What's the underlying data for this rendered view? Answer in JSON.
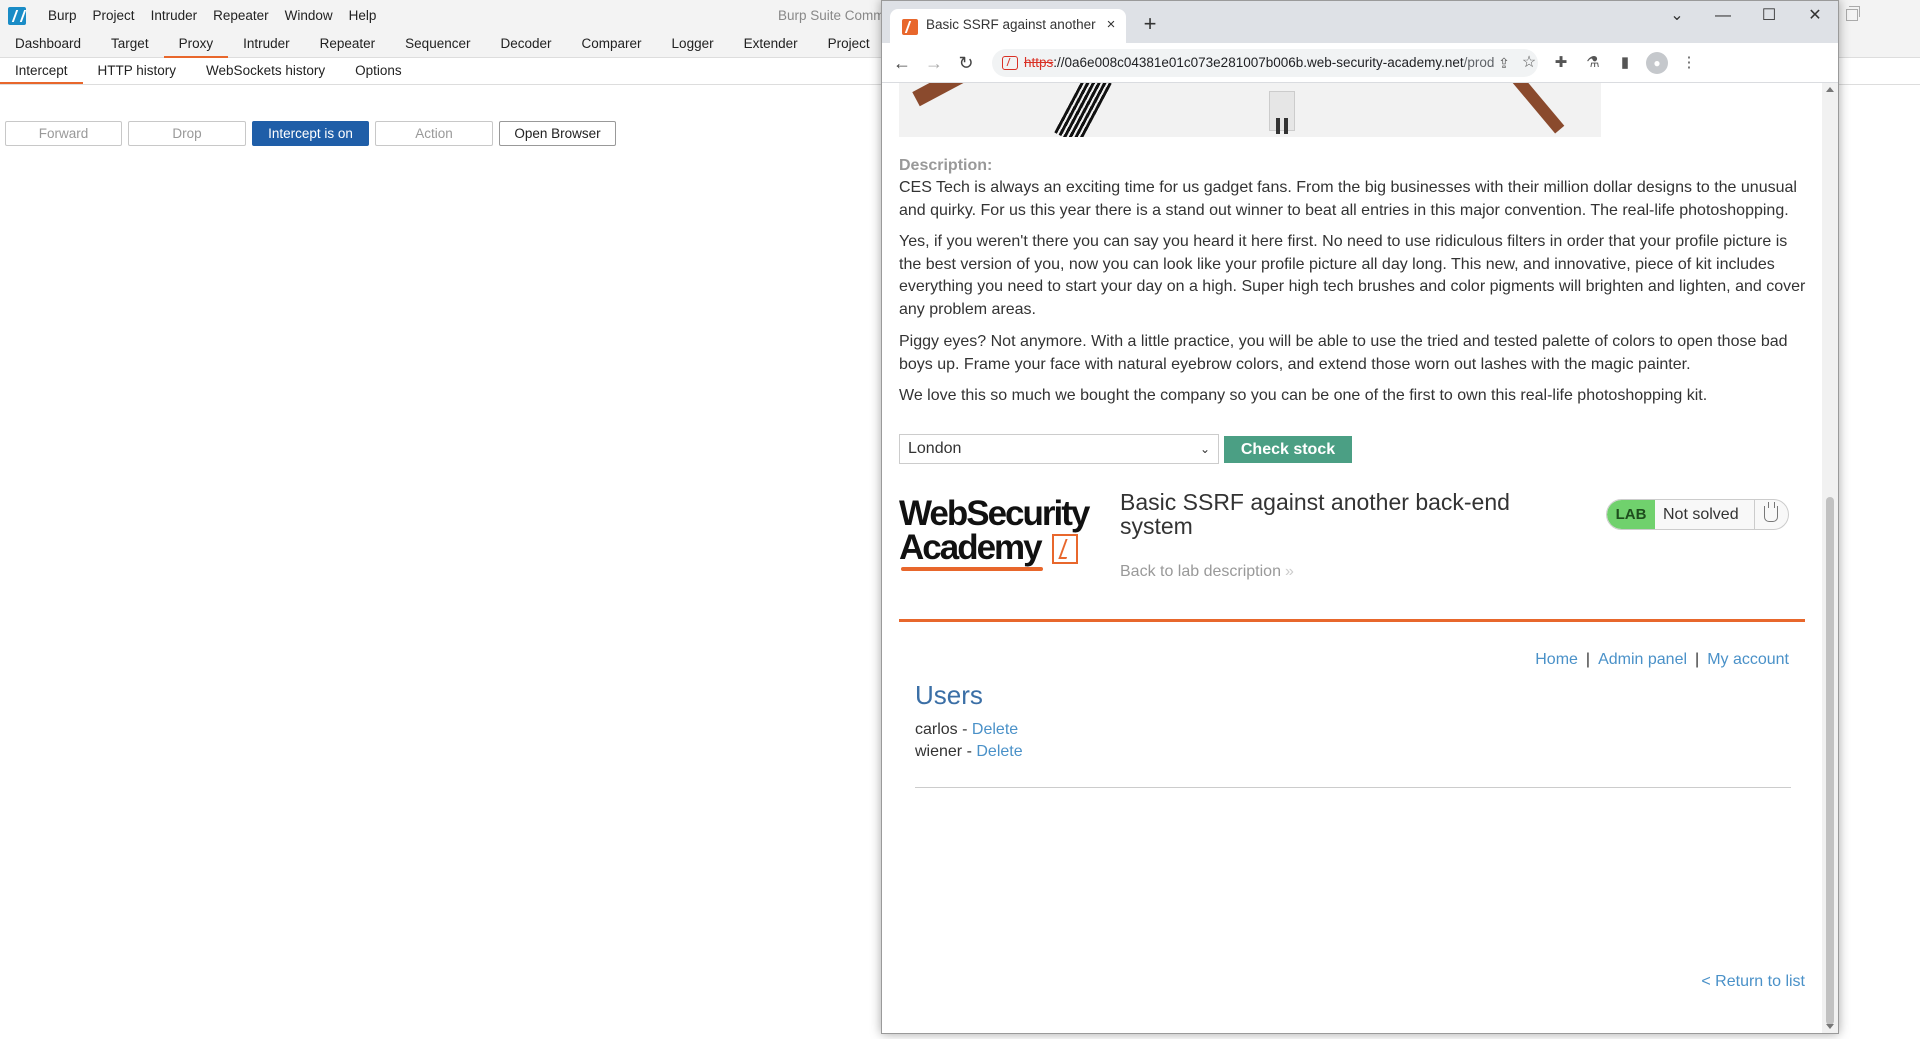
{
  "burp": {
    "menu": [
      "Burp",
      "Project",
      "Intruder",
      "Repeater",
      "Window",
      "Help"
    ],
    "window_title": "Burp Suite Comm",
    "tabs": [
      "Dashboard",
      "Target",
      "Proxy",
      "Intruder",
      "Repeater",
      "Sequencer",
      "Decoder",
      "Comparer",
      "Logger",
      "Extender",
      "Project"
    ],
    "active_tab": "Proxy",
    "subtabs": [
      "Intercept",
      "HTTP history",
      "WebSockets history",
      "Options"
    ],
    "active_subtab": "Intercept",
    "toolbar": {
      "forward": "Forward",
      "drop": "Drop",
      "intercept": "Intercept is on",
      "action": "Action",
      "open_browser": "Open Browser"
    }
  },
  "chrome": {
    "tab_title": "Basic SSRF against another",
    "tab_close": "×",
    "new_tab": "+",
    "window_controls": [
      "⌄",
      "—",
      "☐",
      "✕"
    ],
    "url": {
      "scheme": "https",
      "host": "://0a6e008c04381e01c073e281007b006b.web-security-academy.net",
      "path": "/product?produ..."
    },
    "icons": [
      "back-icon",
      "forward-icon",
      "reload-icon",
      "not-secure-icon",
      "share-icon",
      "star-icon",
      "extensions-icon",
      "lab-flask-icon",
      "side-panel-icon",
      "profile-icon",
      "menu-icon"
    ]
  },
  "page": {
    "description_label": "Description:",
    "paragraphs": [
      "CES Tech is always an exciting time for us gadget fans. From the big businesses with their million dollar designs to the unusual and quirky. For us this year there is a stand out winner to beat all entries in this major convention. The real-life photoshopping.",
      "Yes, if you weren't there you can say you heard it here first. No need to use ridiculous filters in order that your profile picture is the best version of you, now you can look like your profile picture all day long. This new, and innovative, piece of kit includes everything you need to start your day on a high. Super high tech brushes and color pigments will brighten and lighten, and cover any problem areas.",
      "Piggy eyes? Not anymore. With a little practice, you will be able to use the tried and tested palette of colors to open those bad boys up. Frame your face with natural eyebrow colors, and extend those worn out lashes with the magic painter.",
      "We love this so much we bought the company so you can be one of the first to own this real-life photoshopping kit."
    ],
    "store_select": "London",
    "check_stock": "Check stock",
    "logo": {
      "line1": "WebSecurity",
      "line2": "Academy"
    },
    "lab_title": "Basic SSRF against another back-end system",
    "back_link": "Back to lab description",
    "lab_badge": {
      "label": "LAB",
      "status": "Not solved"
    },
    "nav_links": {
      "home": "Home",
      "admin": "Admin panel",
      "account": "My account",
      "sep": "|"
    },
    "users_heading": "Users",
    "users": [
      {
        "name": "carlos",
        "sep": " - ",
        "action": "Delete"
      },
      {
        "name": "wiener",
        "sep": " - ",
        "action": "Delete"
      }
    ],
    "return_link": "< Return to list"
  },
  "colors": {
    "burp_accent": "#e8672c",
    "intercept_on": "#1f5ea8",
    "check_stock_bg": "#4b9f84",
    "lab_badge": "#70d16d",
    "link": "#4a91c8",
    "users_heading": "#3b6fa6"
  }
}
